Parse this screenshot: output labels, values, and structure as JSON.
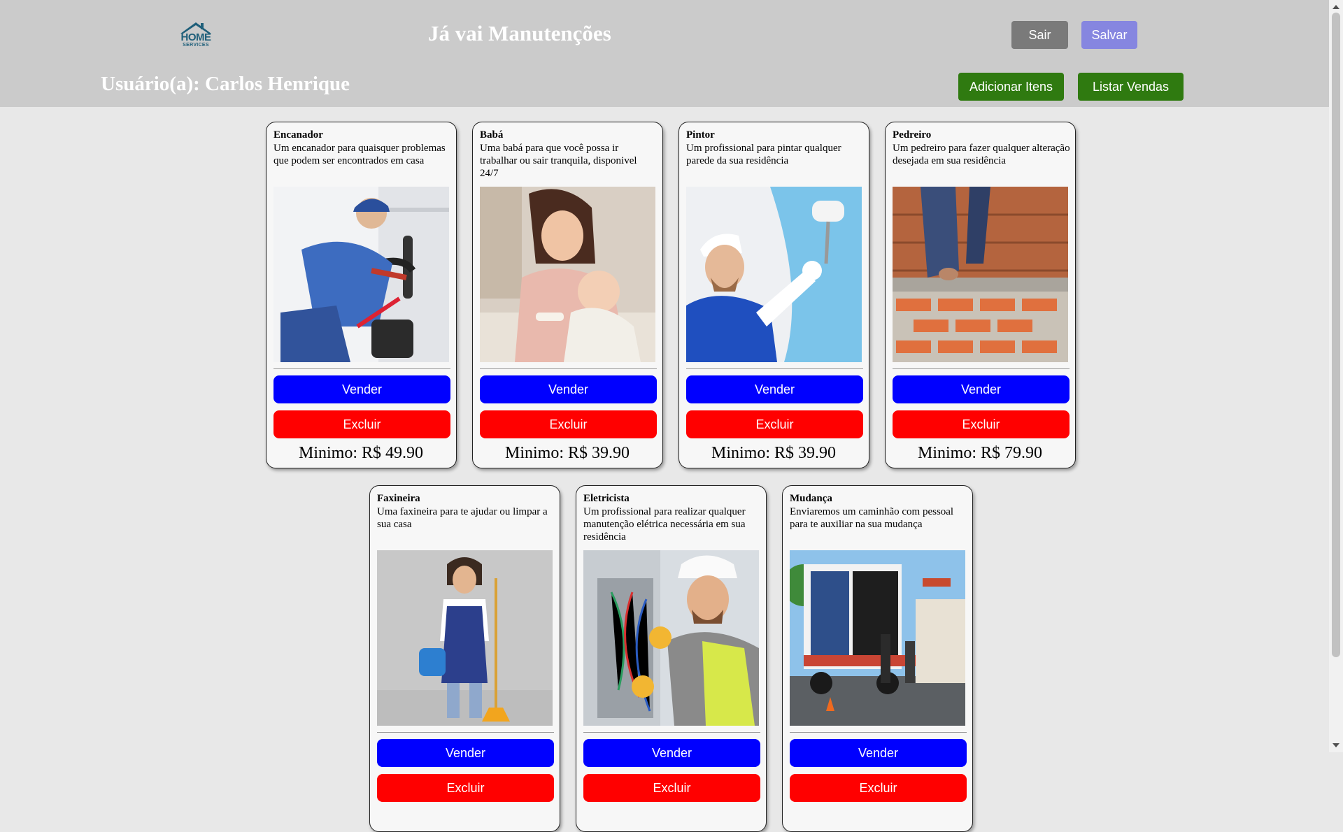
{
  "header": {
    "logo_text_1": "HOME",
    "logo_text_2": "SERVICES",
    "title": "Já vai Manutenções",
    "user_label": "Usuário(a): Carlos Henrique",
    "sair_label": "Sair",
    "salvar_label": "Salvar",
    "add_items_label": "Adicionar Itens",
    "list_sales_label": "Listar Vendas"
  },
  "colors": {
    "header_bg": "#cbcbcb",
    "page_bg": "#e8e8e8",
    "sair": "#7a7a7a",
    "salvar": "#8686e0",
    "green": "#2f7a10",
    "vender": "#0000ff",
    "excluir": "#ff0000"
  },
  "cards": [
    {
      "title": "Encanador",
      "description": "Um encanador para quaisquer problemas que podem ser encontrados em casa",
      "image_icon": "plumber-photo",
      "sell_label": "Vender",
      "delete_label": "Excluir",
      "price": "Minimo: R$ 49.90"
    },
    {
      "title": "Babá",
      "description": "Uma babá para que você possa ir trabalhar ou sair tranquila, disponivel 24/7",
      "image_icon": "nanny-photo",
      "sell_label": "Vender",
      "delete_label": "Excluir",
      "price": "Minimo: R$ 39.90"
    },
    {
      "title": "Pintor",
      "description": "Um profissional para pintar qualquer parede da sua residência",
      "image_icon": "painter-photo",
      "sell_label": "Vender",
      "delete_label": "Excluir",
      "price": "Minimo: R$ 39.90"
    },
    {
      "title": "Pedreiro",
      "description": "Um pedreiro para fazer qualquer alteração desejada em sua residência",
      "image_icon": "bricklayer-photo",
      "sell_label": "Vender",
      "delete_label": "Excluir",
      "price": "Minimo: R$ 79.90"
    },
    {
      "title": "Faxineira",
      "description": "Uma faxineira para te ajudar ou limpar a sua casa",
      "image_icon": "cleaner-photo",
      "sell_label": "Vender",
      "delete_label": "Excluir",
      "price": ""
    },
    {
      "title": "Eletricista",
      "description": "Um profissional para realizar qualquer manutenção elétrica necessária em sua residência",
      "image_icon": "electrician-photo",
      "sell_label": "Vender",
      "delete_label": "Excluir",
      "price": ""
    },
    {
      "title": "Mudança",
      "description": "Enviaremos um caminhão com pessoal para te auxiliar na sua mudança",
      "image_icon": "moving-truck-photo",
      "sell_label": "Vender",
      "delete_label": "Excluir",
      "price": ""
    }
  ]
}
